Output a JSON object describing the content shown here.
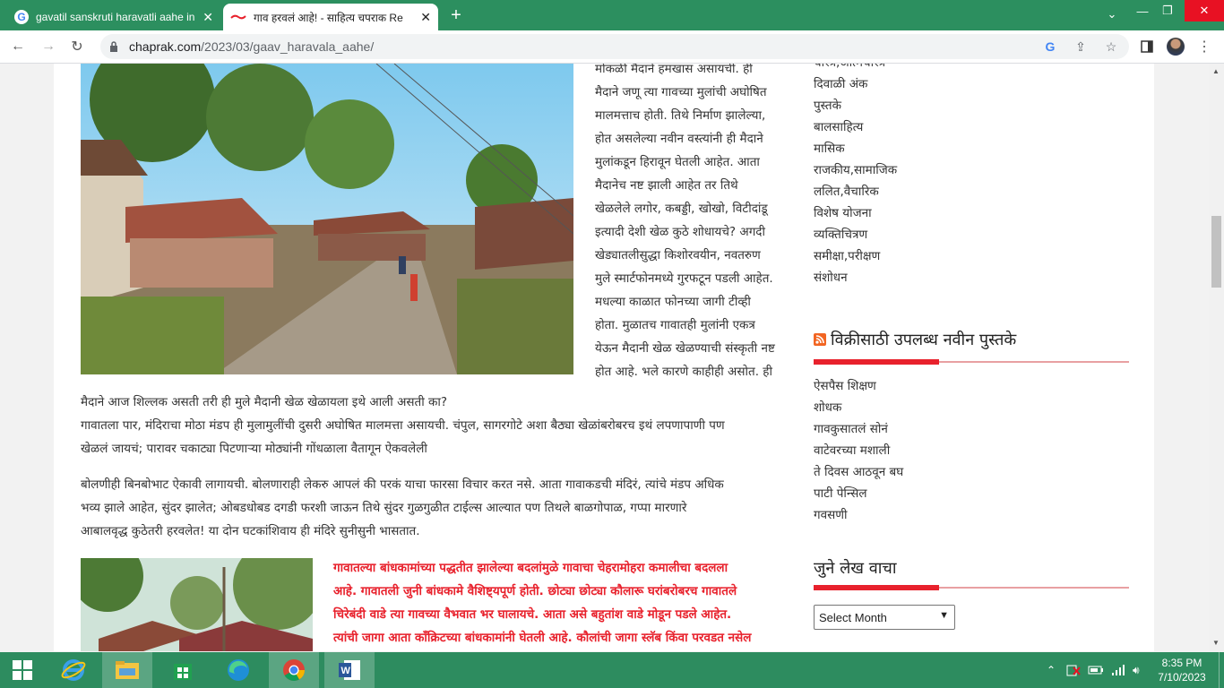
{
  "browser": {
    "tabs": [
      {
        "title": "gavatil sanskruti haravatli aahe in",
        "active": false
      },
      {
        "title": "गाव हरवलं आहे! - साहित्य चपराक Re",
        "active": true
      }
    ],
    "url_domain": "chaprak.com",
    "url_path": "/2023/03/gaav_haravala_aahe/"
  },
  "article": {
    "right_col_lines": [
      "मोकळी मैदाने हमखास असायची. ही",
      "मैदाने जणू त्या गावच्या मुलांची अघोषित",
      "मालमत्ताच होती. तिथे निर्माण झालेल्या,",
      "होत असलेल्या नवीन वस्त्यांनी ही मैदाने",
      "मुलांकडून हिरावून घेतली आहेत. आता",
      "मैदानेच नष्ट झाली आहेत तर तिथे",
      "खेळलेले लगोर, कबड्डी, खोखो, विटीदांडू",
      "इत्यादी देशी खेळ कुठे शोधायचे? अगदी",
      "खेड्यातलीसुद्धा किशोरवयीन, नवतरुण",
      "मुले स्मार्टफोनमध्ये गुरफटून पडली आहेत.",
      "मधल्या काळात फोनच्या जागी टीव्ही",
      "होता. मुळातच गावातही मुलांनी एकत्र",
      "येऊन मैदानी खेळ खेळण्याची संस्कृती नष्ट",
      "होत आहे. भले कारणे काहीही असोत. ही"
    ],
    "full_lines_1": [
      "मैदाने आज शिल्लक असती तरी ही मुले मैदानी खेळ खेळायला इथे आली असती का?",
      "गावातला पार, मंदिराचा मोठा मंडप ही मुलामुलींची दुसरी अघोषित मालमत्ता असायची. चंपुल, सागरगोटे अशा बैठ्या खेळांबरोबरच इथं लपणापाणी पण",
      "खेळलं जायचं; पारावर चकाट्या पिटणाऱ्या मोठ्यांनी गोंधळाला वैतागून ऐकवलेली"
    ],
    "full_lines_2": [
      "बोलणीही बिनबोभाट ऐकावी लागायची. बोलणाराही लेकरु आपलं की परकं याचा फारसा विचार करत नसे. आता गावाकडची मंदिरं, त्यांचे मंडप अधिक",
      "भव्य झाले आहेत, सुंदर झालेत; ओबडधोबड दगडी फरशी जाऊन तिथे सुंदर गुळगुळीत टाईल्स आल्यात पण तिथले बाळगोपाळ, गप्पा मारणारे",
      "आबालवृद्ध कुठेतरी हरवलेत! या दोन घटकांशिवाय ही मंदिरे सुनीसुनी भासतात."
    ],
    "highlight_lines": [
      "गावातल्या बांधकामांच्या पद्धतीत झालेल्या बदलांमुळे गावाचा चेहरामोहरा कमालीचा बदलला",
      "आहे. गावातली जुनी बांधकामे वैशिष्ट्यपूर्ण होती. छोट्या छोट्या कौलारू घरांबरोबरच गावातले",
      "चिरेबंदी वाडे त्या गावच्या वैभवात भर घालायचे. आता असे बहुतांश वाडे मोडून पडले आहेत.",
      "त्यांची जागा आता कॉंक्रिटच्या बांधकामांनी घेतली आहे. कौलांची जागा स्लॅब किंवा परवडत नसेल"
    ]
  },
  "sidebar": {
    "categories": [
      "चरित्र,आत्मचरित्र",
      "दिवाळी अंक",
      "पुस्तके",
      "बालसाहित्य",
      "मासिक",
      "राजकीय,सामाजिक",
      "ललित,वैचारिक",
      "विशेष योजना",
      "व्यक्तिचित्रण",
      "समीक्षा,परीक्षण",
      "संशोधन"
    ],
    "books_title": "विक्रीसाठी उपलब्ध नवीन पुस्तके",
    "books": [
      "ऐसपैस शिक्षण",
      "शोधक",
      "गावकुसातलं सोनं",
      "वाटेवरच्या मशाली",
      "ते दिवस आठवून बघ",
      "पाटी पेन्सिल",
      "गवसणी"
    ],
    "archive_title": "जुने लेख वाचा",
    "archive_select": "Select Month"
  },
  "taskbar": {
    "time": "8:35 PM",
    "date": "7/10/2023"
  },
  "colors": {
    "accent_red": "#e8212c",
    "taskbar_green": "#2d8c5f",
    "tab_green": "#2c8f5f"
  }
}
